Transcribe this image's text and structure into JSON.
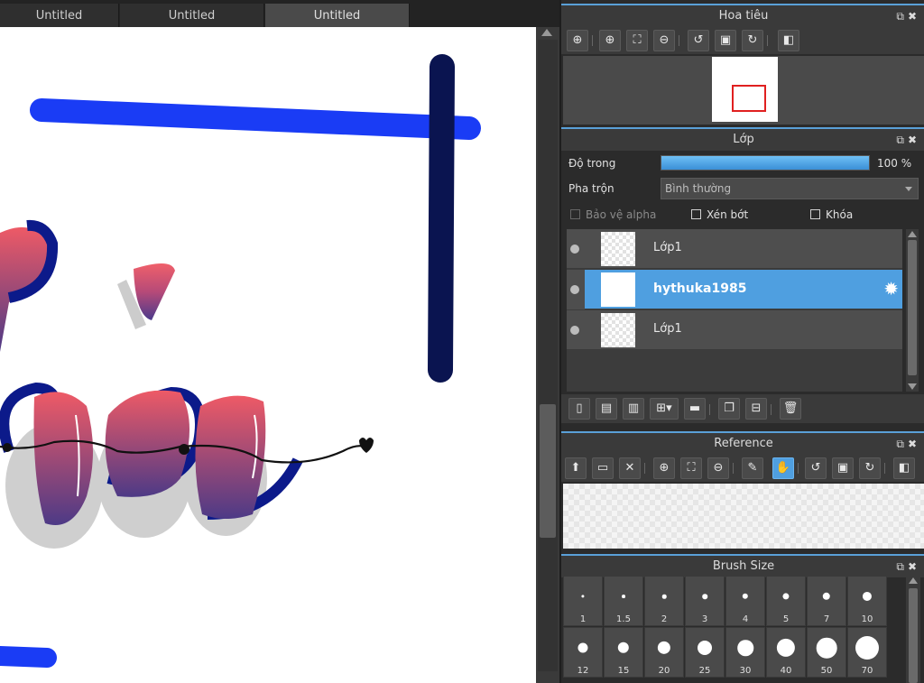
{
  "tabs": [
    {
      "label": "Untitled",
      "active": false
    },
    {
      "label": "Untitled",
      "active": false
    },
    {
      "label": "Untitled",
      "active": true
    }
  ],
  "navigator": {
    "title": "Hoa tiêu",
    "panel_controls": "⧉✖"
  },
  "layer_panel": {
    "title": "Lớp",
    "panel_controls": "⧉✖",
    "opacity_label": "Độ trong",
    "opacity_value": "100 %",
    "opacity_fraction": 1.0,
    "blend_label": "Pha trộn",
    "blend_value": "Bình thường",
    "protect_alpha_label": "Bảo vệ alpha",
    "clipping_label": "Xén bớt",
    "lock_label": "Khóa",
    "layers": [
      {
        "name": "Lớp1",
        "selected": false
      },
      {
        "name": "hythuka1985",
        "selected": true
      },
      {
        "name": "Lớp1",
        "selected": false
      }
    ]
  },
  "reference": {
    "title": "Reference",
    "panel_controls": "⧉✖"
  },
  "brush_size": {
    "title": "Brush Size",
    "panel_controls": "⧉✖",
    "sizes": [
      "1",
      "1.5",
      "2",
      "3",
      "4",
      "5",
      "7",
      "10",
      "12",
      "15",
      "20",
      "25",
      "30",
      "40",
      "50",
      "70"
    ]
  },
  "colors": {
    "accent": "#4f9fe0",
    "stroke_blue": "#1a3cf5",
    "stroke_navy": "#0a1450",
    "pink": "#e2566a",
    "purple": "#5a3c8c"
  }
}
